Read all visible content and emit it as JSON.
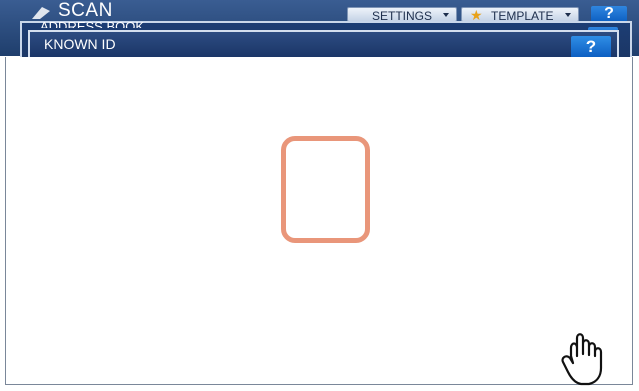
{
  "app": {
    "title": "SCAN",
    "icon": "scan-icon"
  },
  "toolbar": {
    "settings_label": "SETTINGS",
    "template_label": "TEMPLATE",
    "template_icon": "star-icon",
    "help_label": "?"
  },
  "address_dialog": {
    "title": "ADDRESS BOOK"
  },
  "known_id_dialog": {
    "title": "KNOWN ID",
    "help_label": "?"
  },
  "colors": {
    "title_bar": "#1f3e6c",
    "help_button": "#0d5fc2",
    "highlight": "#e9967a"
  }
}
